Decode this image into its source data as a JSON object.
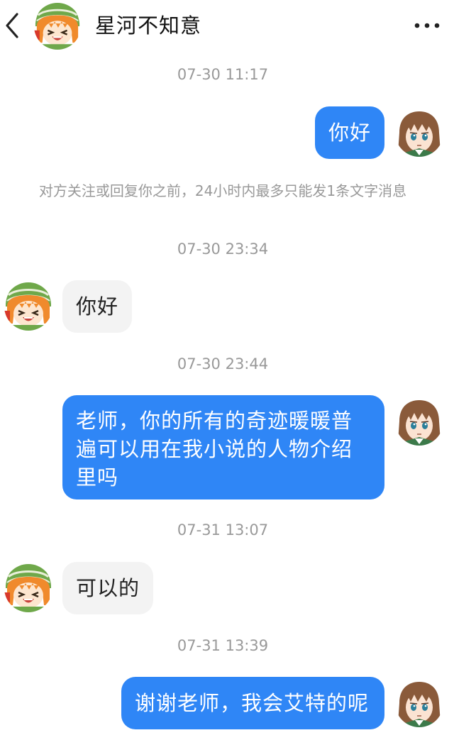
{
  "header": {
    "title": "星河不知意"
  },
  "system": {
    "notice": "对方关注或回复你之前，24小时内最多只能发1条文字消息"
  },
  "messages": [
    {
      "timestamp": "07-30 11:17",
      "text": "你好"
    },
    {
      "timestamp": "07-30 23:34",
      "text": "你好"
    },
    {
      "timestamp": "07-30 23:44",
      "text": "老师，你的所有的奇迹暖暖普遍可以用在我小说的人物介绍里吗"
    },
    {
      "timestamp": "07-31 13:07",
      "text": "可以的"
    },
    {
      "timestamp": "07-31 13:39",
      "text": "谢谢老师，我会艾特的呢"
    }
  ],
  "colors": {
    "my_bubble": "#2f86f6",
    "their_bubble": "#f3f3f3",
    "timestamp": "#999999"
  },
  "icons": {
    "back": "chevron-left-icon",
    "more": "more-dots-icon"
  }
}
